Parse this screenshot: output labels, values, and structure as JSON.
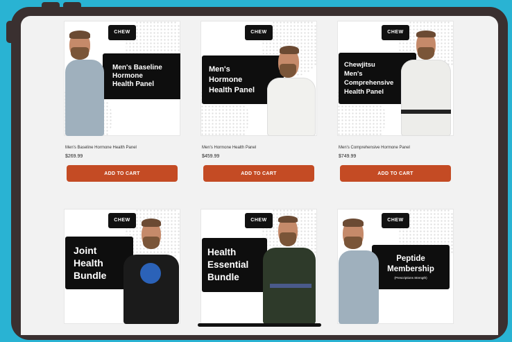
{
  "brand_logo_text": "CHEW JITSU",
  "colors": {
    "accent": "#c44b24",
    "background": "#29b3d3",
    "device_frame": "#3a3030"
  },
  "products": [
    {
      "image_lines": [
        "Men's Baseline",
        "Hormone",
        "Health Panel"
      ],
      "name": "Men's Baseline Hormone Health Panel",
      "price": "$269.99",
      "button": "ADD TO CART"
    },
    {
      "image_lines": [
        "Men's",
        "Hormone",
        "Health Panel"
      ],
      "name": "Men's Hormone Health Panel",
      "price": "$459.99",
      "button": "ADD TO CART"
    },
    {
      "image_lines": [
        "Chewjitsu",
        "Men's",
        "Comprehensive",
        "Health Panel"
      ],
      "name": "Men's Comprehensive Hormone Panel",
      "price": "$749.99",
      "button": "ADD TO CART"
    },
    {
      "image_lines": [
        "Joint",
        "Health",
        "Bundle"
      ]
    },
    {
      "image_lines": [
        "Health",
        "Essential",
        "Bundle"
      ]
    },
    {
      "image_lines": [
        "Peptide",
        "Membership"
      ],
      "image_subline": "(Prescriptions Strength)"
    }
  ]
}
